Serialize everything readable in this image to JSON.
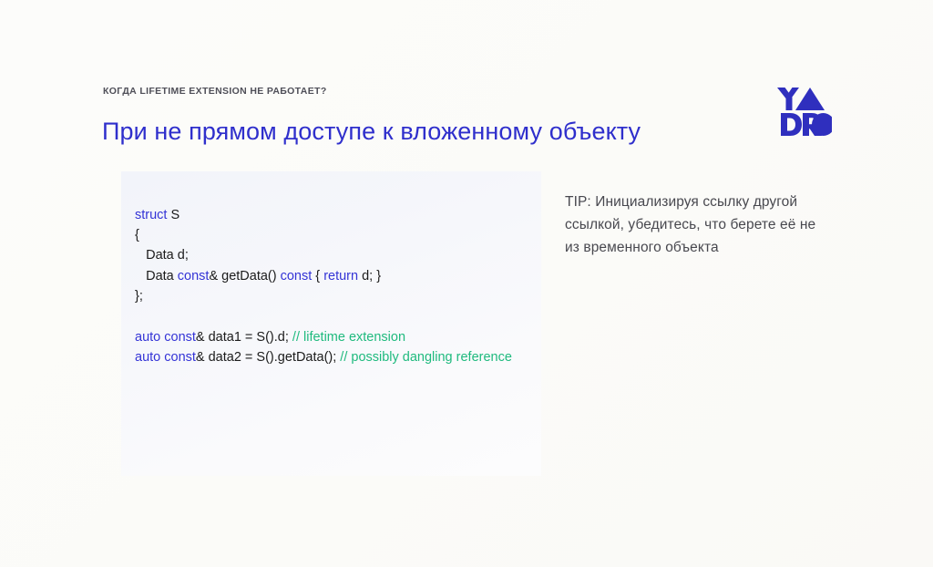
{
  "slide": {
    "eyebrow": "КОГДА LIFETIME EXTENSION НЕ РАБОТАЕТ?",
    "title": "При не прямом доступе к вложенному объекту",
    "background_color": "#fbfbf9",
    "title_color": "#2f2fcc",
    "eyebrow_color": "#4f4f58"
  },
  "logo": {
    "name": "YADRO",
    "color": "#2f2fbe"
  },
  "code_panel": {
    "background_color": "#f4f5fa",
    "keyword_color": "#3434d6",
    "comment_color": "#1fba7e",
    "text_color": "#1b1b1b",
    "lines": [
      {
        "segments": [
          {
            "t": "struct ",
            "c": "kw"
          },
          {
            "t": "S",
            "c": "pl"
          }
        ]
      },
      {
        "segments": [
          {
            "t": "{",
            "c": "pl"
          }
        ]
      },
      {
        "segments": [
          {
            "t": "   Data d;",
            "c": "pl"
          }
        ]
      },
      {
        "segments": [
          {
            "t": "   Data ",
            "c": "pl"
          },
          {
            "t": "const",
            "c": "kw"
          },
          {
            "t": "& getData() ",
            "c": "pl"
          },
          {
            "t": "const",
            "c": "kw"
          },
          {
            "t": " { ",
            "c": "pl"
          },
          {
            "t": "return",
            "c": "kw"
          },
          {
            "t": " d; }",
            "c": "pl"
          }
        ]
      },
      {
        "segments": [
          {
            "t": "};",
            "c": "pl"
          }
        ]
      },
      {
        "segments": []
      },
      {
        "segments": [
          {
            "t": "auto const",
            "c": "kw"
          },
          {
            "t": "& data1 = S().d; ",
            "c": "pl"
          },
          {
            "t": "// lifetime extension",
            "c": "cmt"
          }
        ]
      },
      {
        "segments": [
          {
            "t": "auto const",
            "c": "kw"
          },
          {
            "t": "& data2 = S().getData(); ",
            "c": "pl"
          },
          {
            "t": "// possibly dangling reference",
            "c": "cmt"
          }
        ]
      }
    ]
  },
  "tip": {
    "text": "TIP: Инициализируя ссылку другой ссылкой, убедитесь, что берете её не из временного объекта",
    "color": "#48484f"
  }
}
